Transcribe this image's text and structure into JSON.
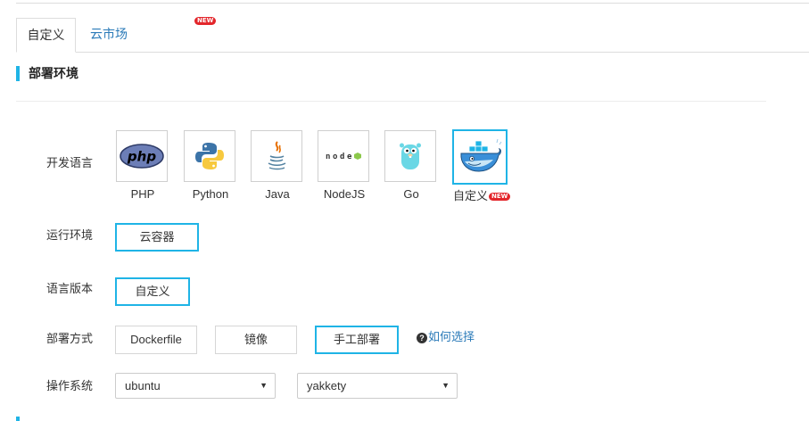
{
  "tabs": [
    {
      "label": "自定义",
      "active": true
    },
    {
      "label": "云市场",
      "badge": "NEW",
      "active": false
    }
  ],
  "section": {
    "title": "部署环境"
  },
  "form": {
    "language": {
      "label": "开发语言",
      "options": [
        {
          "name": "PHP",
          "icon": "php-logo-icon"
        },
        {
          "name": "Python",
          "icon": "python-logo-icon"
        },
        {
          "name": "Java",
          "icon": "java-logo-icon"
        },
        {
          "name": "NodeJS",
          "icon": "nodejs-logo-icon"
        },
        {
          "name": "Go",
          "icon": "go-gopher-icon"
        },
        {
          "name": "自定义",
          "icon": "docker-whale-icon",
          "badge": "NEW",
          "selected": true
        }
      ]
    },
    "runtime": {
      "label": "运行环境",
      "options": [
        {
          "label": "云容器",
          "selected": true
        }
      ]
    },
    "lang_version": {
      "label": "语言版本",
      "options": [
        {
          "label": "自定义",
          "selected": true
        }
      ]
    },
    "deploy": {
      "label": "部署方式",
      "options": [
        {
          "label": "Dockerfile",
          "selected": false
        },
        {
          "label": "镜像",
          "selected": false
        },
        {
          "label": "手工部署",
          "selected": true
        }
      ],
      "help": "如何选择"
    },
    "os": {
      "label": "操作系统",
      "distro": "ubuntu",
      "release": "yakkety"
    }
  },
  "colors": {
    "accent": "#1fb4e6",
    "link": "#2a7ab8",
    "badge": "#e3262b"
  }
}
